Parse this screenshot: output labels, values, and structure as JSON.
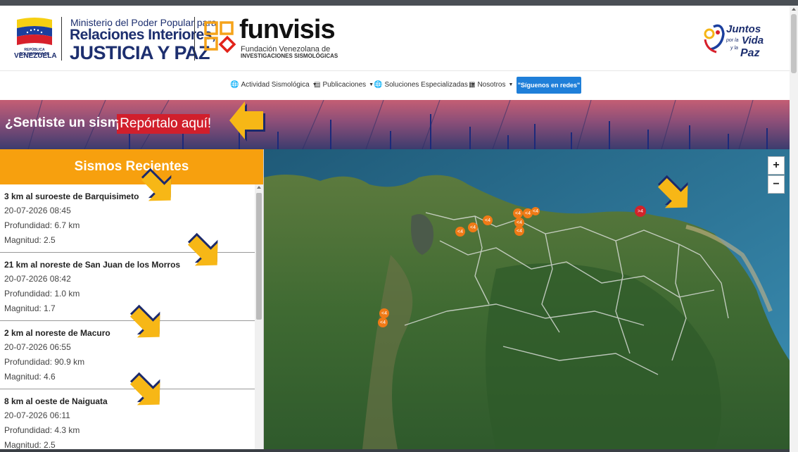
{
  "header": {
    "emblem_small": "REPÚBLICA BOLIVARIANA DE",
    "emblem_country": "VENEZUELA",
    "ministry_line1": "Ministerio del Poder Popular para",
    "ministry_line2": "Relaciones Interiores,",
    "ministry_line3": "JUSTICIA Y PAZ",
    "funvisis_name": "funvisis",
    "funvisis_sub1": "Fundación Venezolana de",
    "funvisis_sub2": "INVESTIGACIONES SISMOLÓGICAS",
    "juntos_l1": "Juntos",
    "juntos_l2": "por la",
    "juntos_l3": "Vida",
    "juntos_l4": "y la",
    "juntos_l5": "Paz"
  },
  "nav": {
    "items": [
      {
        "label": "Actividad Sismológica",
        "icon": "globe-icon"
      },
      {
        "label": "Publicaciones",
        "icon": "document-icon"
      },
      {
        "label": "Soluciones Especializadas",
        "icon": "globe-icon"
      },
      {
        "label": "Nosotros",
        "icon": "book-icon"
      }
    ],
    "social_label": "\"Síguenos en redes\""
  },
  "banner": {
    "question": "¿Sentiste un sismo?",
    "report_label": "¡Repórtalo aquí!"
  },
  "sidebar": {
    "title": "Sismos Recientes",
    "quakes": [
      {
        "title": "3 km al suroeste de Barquisimeto",
        "datetime": "20-07-2026 08:45",
        "depth": "Profundidad: 6.7 km",
        "magnitude": "Magnitud: 2.5"
      },
      {
        "title": "21 km al noreste de San Juan de los Morros",
        "datetime": "20-07-2026 08:42",
        "depth": "Profundidad: 1.0 km",
        "magnitude": "Magnitud: 1.7"
      },
      {
        "title": "2 km al noreste de Macuro",
        "datetime": "20-07-2026 06:55",
        "depth": "Profundidad: 90.9 km",
        "magnitude": "Magnitud: 4.6"
      },
      {
        "title": "8 km al oeste de Naiguata",
        "datetime": "20-07-2026 06:11",
        "depth": "Profundidad: 4.3 km",
        "magnitude": "Magnitud: 2.5"
      }
    ]
  },
  "map": {
    "zoom_in": "+",
    "zoom_out": "−",
    "marker_lt4": "<4",
    "marker_gt4": ">4"
  },
  "colors": {
    "accent_orange": "#f7a00e",
    "report_red": "#d11f2c",
    "social_blue": "#1f7fd9",
    "brand_navy": "#1d2f6f",
    "marker_orange": "#f07a16",
    "marker_red": "#d2232a"
  }
}
